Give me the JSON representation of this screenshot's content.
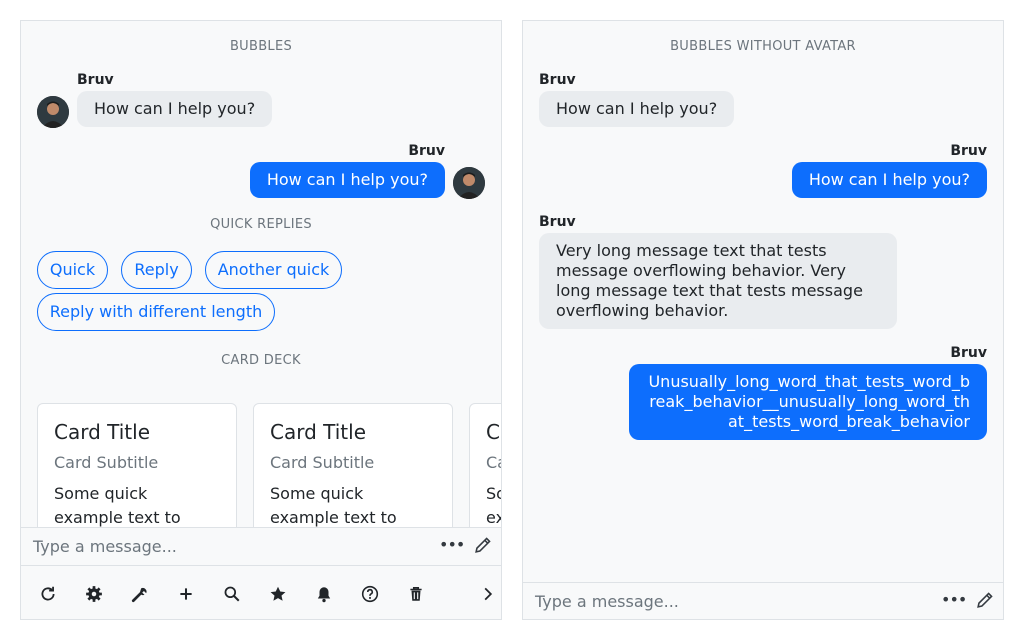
{
  "left_panel": {
    "bubbles_title": "BUBBLES",
    "messages": [
      {
        "sender": "Bruv",
        "text": "How can I help you?"
      },
      {
        "sender": "Bruv",
        "text": "How can I help you?"
      }
    ],
    "quick_replies_title": "QUICK REPLIES",
    "quick_replies": [
      "Quick",
      "Reply",
      "Another quick",
      "Reply with different length"
    ],
    "card_deck_title": "CARD DECK",
    "cards": [
      {
        "title": "Card Title",
        "subtitle": "Card Subtitle",
        "text": "Some quick example text to"
      },
      {
        "title": "Card Title",
        "subtitle": "Card Subtitle",
        "text": "Some quick example text to"
      },
      {
        "title": "Card Title",
        "subtitle": "Card Subtitle",
        "text": "Some quick example text to"
      }
    ],
    "composer": {
      "placeholder": "Type a message..."
    },
    "toolbar": {
      "icons": [
        "refresh-icon",
        "gear-icon",
        "wrench-icon",
        "plus-icon",
        "search-icon",
        "star-icon",
        "bell-icon",
        "help-icon",
        "trash-icon",
        "chevron-right-icon"
      ]
    }
  },
  "right_panel": {
    "title": "BUBBLES WITHOUT AVATAR",
    "messages": [
      {
        "sender": "Bruv",
        "text": "How can I help you?"
      },
      {
        "sender": "Bruv",
        "text": "How can I help you?"
      },
      {
        "sender": "Bruv",
        "text": "Very long message text that tests message overflowing behavior. Very long message text that tests message overflowing behavior."
      },
      {
        "sender": "Bruv",
        "text": "Unusually_long_word_that_tests_word_break_behavior__unusually_long_word_that_tests_word_break_behavior"
      }
    ],
    "composer": {
      "placeholder": "Type a message..."
    }
  },
  "colors": {
    "accent": "#0d6efd",
    "incoming_bubble": "#e9ecef",
    "panel_bg": "#f8f9fa",
    "border": "#dee2e6"
  }
}
